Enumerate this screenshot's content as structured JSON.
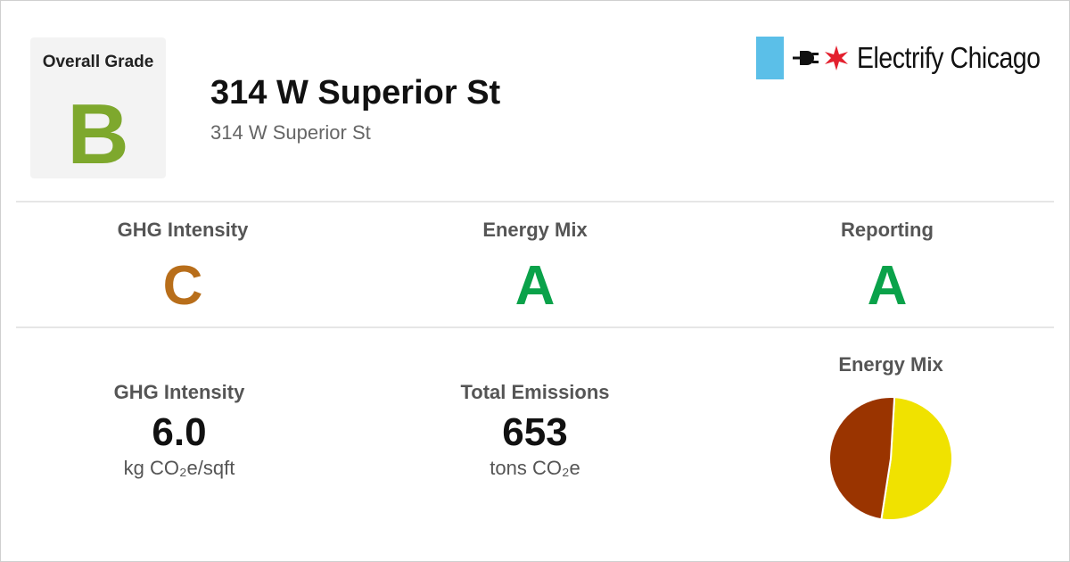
{
  "overall": {
    "label": "Overall Grade",
    "grade": "B",
    "grade_color": "#7ea82d"
  },
  "building": {
    "name": "314 W Superior St",
    "address": "314 W Superior St"
  },
  "logo": {
    "text": "Electrify Chicago",
    "flag_color": "#5bbfe8",
    "star_color": "#e3202e",
    "icons": [
      "plug-icon",
      "red-star-icon"
    ]
  },
  "grades": [
    {
      "label": "GHG Intensity",
      "grade": "C",
      "color": "#b86e1a"
    },
    {
      "label": "Energy Mix",
      "grade": "A",
      "color": "#0aa24a"
    },
    {
      "label": "Reporting",
      "grade": "A",
      "color": "#0aa24a"
    }
  ],
  "stats": [
    {
      "label": "GHG Intensity",
      "value": "6.0",
      "unit": "kg CO₂e/sqft"
    },
    {
      "label": "Total Emissions",
      "value": "653",
      "unit": "tons CO₂e"
    }
  ],
  "chart_data": {
    "type": "pie",
    "title": "Energy Mix",
    "slices": [
      {
        "fraction": 0.515,
        "color": "#f0e200"
      },
      {
        "fraction": 0.485,
        "color": "#9a3400"
      }
    ]
  }
}
